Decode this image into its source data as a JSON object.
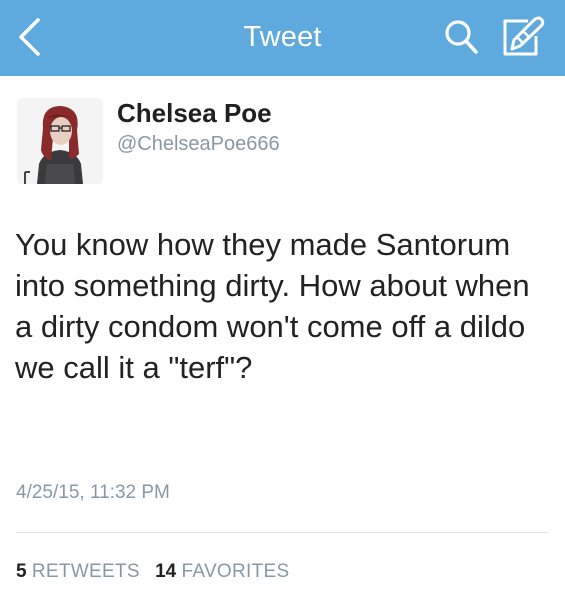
{
  "colors": {
    "nav_background": "#5ea9dd",
    "nav_foreground": "#ffffff",
    "primary_text": "#222222",
    "secondary_text": "#8899a6",
    "divider": "#dfe3e7"
  },
  "navbar": {
    "title": "Tweet",
    "back_icon": "chevron-left-icon",
    "search_icon": "search-icon",
    "compose_icon": "compose-icon"
  },
  "tweet": {
    "author": {
      "name": "Chelsea Poe",
      "handle": "@ChelseaPoe666"
    },
    "text": "You know how they made Santorum into something dirty. How about when a dirty condom won't come off a dildo we call it a \"terf\"?",
    "timestamp": "4/25/15, 11:32 PM"
  },
  "stats": {
    "retweets_count": "5",
    "retweets_label": "RETWEETS",
    "favorites_count": "14",
    "favorites_label": "FAVORITES"
  }
}
